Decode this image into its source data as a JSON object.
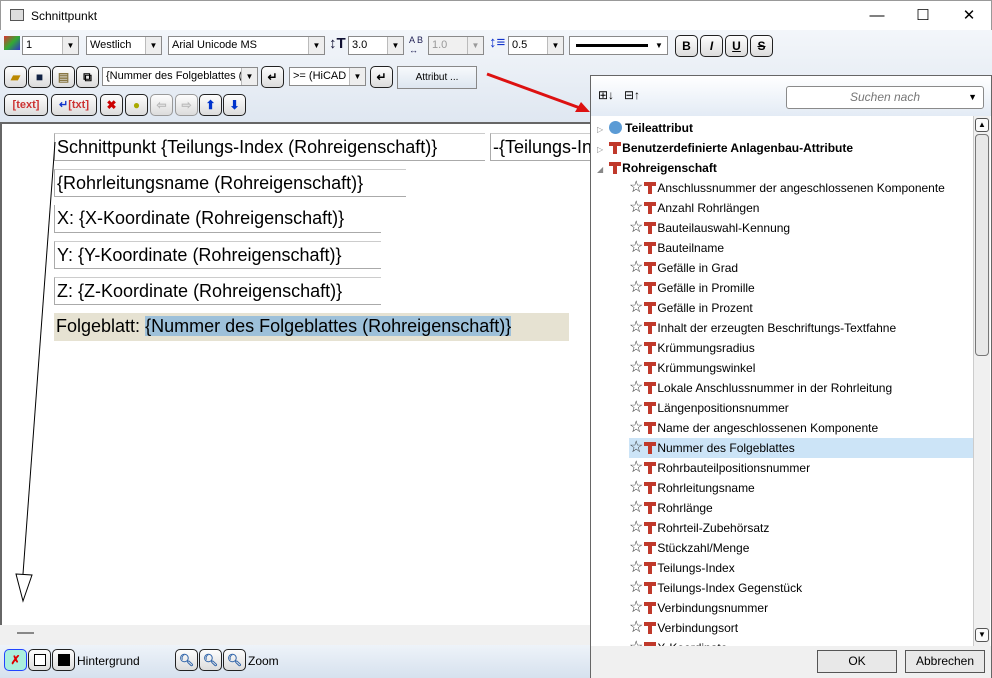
{
  "window": {
    "title": "Schnittpunkt",
    "minimize": "—",
    "maximize": "☐",
    "close": "✕"
  },
  "toolbar": {
    "layer": "1",
    "direction": "Westlich",
    "font": "Arial Unicode MS",
    "height": "3.0",
    "spacing": "1.0",
    "line_spacing": "0.5",
    "bold": "B",
    "italic": "I",
    "underline": "U",
    "strike": "S",
    "attribute_combo": "{Nummer des Folgeblattes (R",
    "operator_combo": ">= (HiCAD",
    "attribut_button": "Attribut ...",
    "text_button": "text",
    "enter_text_button": "txt"
  },
  "editor": {
    "lines": [
      "Schnittpunkt {Teilungs-Index (Rohreigenschaft)}",
      "-{Teilungs-Index Gegenstück (Rohreigenschaft)}",
      "{Rohrleitungsname (Rohreigenschaft)}",
      "X: {X-Koordinate (Rohreigenschaft)}",
      "Y: {Y-Koordinate (Rohreigenschaft)}",
      "Z: {Z-Koordinate (Rohreigenschaft)}"
    ],
    "last_prefix": "Folgeblatt: ",
    "last_selected": "{Nummer des Folgeblattes (Rohreigenschaft)}"
  },
  "bottom": {
    "background_label": "Hintergrund",
    "zoom_label": "Zoom"
  },
  "panel": {
    "search_placeholder": "Suchen nach",
    "groups": [
      "Teileattribut",
      "Benutzerdefinierte Anlagenbau-Attribute",
      "Rohreigenschaft"
    ],
    "items": [
      "Anschlussnummer der angeschlossenen Komponente",
      "Anzahl Rohrlängen",
      "Bauteilauswahl-Kennung",
      "Bauteilname",
      "Gefälle in Grad",
      "Gefälle in Promille",
      "Gefälle in Prozent",
      "Inhalt der erzeugten Beschriftungs-Textfahne",
      "Krümmungsradius",
      "Krümmungswinkel",
      "Lokale Anschlussnummer in der Rohrleitung",
      "Längenpositionsnummer",
      "Name der angeschlossenen Komponente",
      "Nummer des Folgeblattes",
      "Rohrbauteilpositionsnummer",
      "Rohrleitungsname",
      "Rohrlänge",
      "Rohrteil-Zubehörsatz",
      "Stückzahl/Menge",
      "Teilungs-Index",
      "Teilungs-Index Gegenstück",
      "Verbindungsnummer",
      "Verbindungsort",
      "X-Koordinate"
    ],
    "selected_index": 13,
    "ok": "OK",
    "cancel": "Abbrechen"
  }
}
